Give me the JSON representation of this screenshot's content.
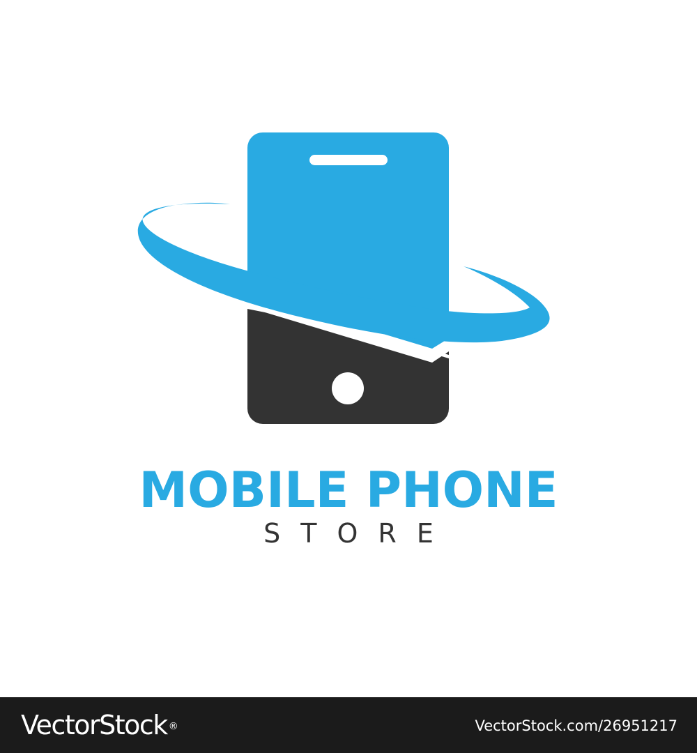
{
  "logo": {
    "title": "MOBILE PHONE",
    "subtitle": "STORE",
    "icon": "smartphone-with-orbit-ring-icon",
    "colors": {
      "primary_blue": "#29aae2",
      "dark_gray": "#333333",
      "white": "#ffffff"
    }
  },
  "watermark": {
    "brand": "VectorStock",
    "brand_mark": "®",
    "image_id": "VectorStock.com/26951217",
    "background_color": "#1b1b1b",
    "text_color": "#ffffff"
  }
}
